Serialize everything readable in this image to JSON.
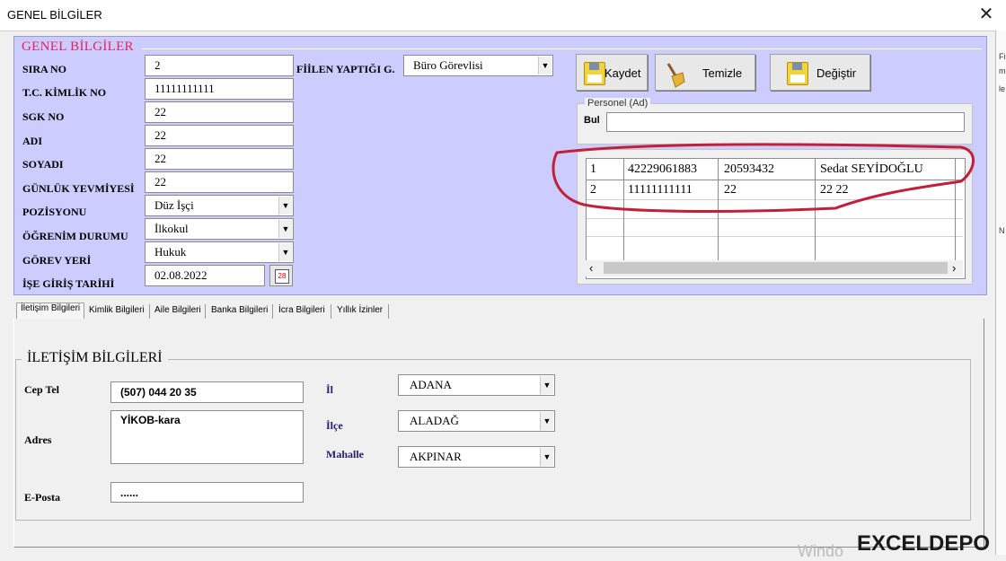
{
  "window": {
    "title": "GENEL BİLGİLER",
    "close_glyph": "✕"
  },
  "frame": {
    "title": "GENEL BİLGİLER"
  },
  "fields": {
    "sira_no": {
      "label": "SIRA NO",
      "value": "2"
    },
    "tc": {
      "label": "T.C. KİMLİK NO",
      "value": "11111111111"
    },
    "sgk": {
      "label": "SGK NO",
      "value": "22"
    },
    "adi": {
      "label": "ADI",
      "value": "22"
    },
    "soyadi": {
      "label": "SOYADI",
      "value": "22"
    },
    "yevmiye": {
      "label": "GÜNLÜK YEVMİYESİ",
      "value": "22"
    },
    "pozisyon": {
      "label": "POZİSYONU",
      "value": "Düz İşçi"
    },
    "ogrenim": {
      "label": "ÖĞRENİM DURUMU",
      "value": "İlkokul"
    },
    "gorev": {
      "label": "GÖREV YERİ",
      "value": "Hukuk"
    },
    "giris": {
      "label": "İŞE GİRİŞ TARİHİ",
      "value": "02.08.2022",
      "calendar_glyph": "28"
    },
    "fiilen": {
      "label": "FİİLEN YAPTIĞI G.",
      "value": "Büro Görevlisi"
    }
  },
  "buttons": {
    "save": "Kaydet",
    "clear": "Temizle",
    "change": "Değiştir"
  },
  "search": {
    "group_caption": "Personel (Ad)",
    "label": "Bul",
    "value": ""
  },
  "grid": {
    "rows": [
      [
        "1",
        "42229061883",
        "20593432",
        "Sedat SEYİDOĞLU"
      ],
      [
        "2",
        "11111111111",
        "22",
        "22 22"
      ]
    ],
    "scroll_left": "‹",
    "scroll_right": "›"
  },
  "tabs": [
    "İletişim Bilgileri",
    "Kimlik Bilgileri",
    "Aile Bilgileri",
    "Banka Bilgileri",
    "İcra Bilgileri",
    "Yıllık İzinler"
  ],
  "contact": {
    "title": "İLETİŞİM BİLGİLERİ",
    "cep_label": "Cep Tel",
    "cep_value": "(507) 044 20 35",
    "adres_label": "Adres",
    "adres_value": "YİKOB-kara",
    "eposta_label": "E-Posta",
    "eposta_value": "......",
    "il_label": "İl",
    "il_value": "ADANA",
    "ilce_label": "İlçe",
    "ilce_value": "ALADAĞ",
    "mahalle_label": "Mahalle",
    "mahalle_value": "AKPINAR"
  },
  "branding": {
    "logo": "EXCELDEPO",
    "watermark": "Windo"
  },
  "side_strip": [
    "Fi",
    "m",
    "le",
    "N"
  ],
  "colors": {
    "frame_bg": "#ccccff",
    "frame_title": "#e0245e",
    "annotation": "#c0203a"
  }
}
